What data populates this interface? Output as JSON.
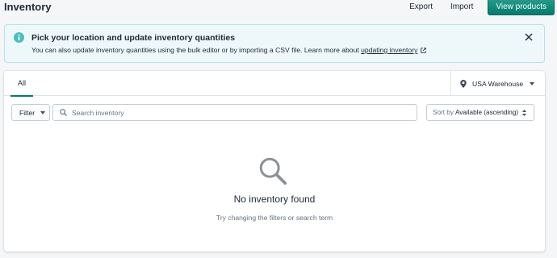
{
  "header": {
    "title": "Inventory",
    "export_label": "Export",
    "import_label": "Import",
    "view_products_label": "View products"
  },
  "banner": {
    "title": "Pick your location and update inventory quantities",
    "body_prefix": "You can also update inventory quantities using the bulk editor or by importing a CSV file. Learn more about ",
    "link_text": "updating inventory",
    "accent_color": "#47c1bf"
  },
  "tabs": [
    {
      "label": "All",
      "selected": true
    }
  ],
  "location": {
    "selected": "USA Warehouse"
  },
  "toolbar": {
    "filter_label": "Filter",
    "search_placeholder": "Search inventory",
    "search_value": "",
    "sort_prefix": "Sort by",
    "sort_value": "Available (ascending)"
  },
  "empty_state": {
    "icon": "search-icon",
    "title": "No inventory found",
    "subtitle": "Try changing the filters or search term"
  },
  "colors": {
    "primary": "#008060",
    "text": "#212b36",
    "subdued": "#637381"
  }
}
